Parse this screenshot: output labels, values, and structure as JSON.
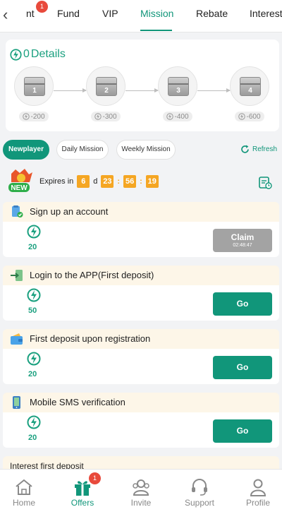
{
  "top_tabs": {
    "back_icon": "chevron-left-icon",
    "tabs": [
      {
        "label": "nt",
        "badge": "1"
      },
      {
        "label": "Fund"
      },
      {
        "label": "VIP"
      },
      {
        "label": "Mission",
        "active": true
      },
      {
        "label": "Rebate"
      },
      {
        "label": "Interest"
      }
    ]
  },
  "details": {
    "points": "0",
    "label": "Details",
    "chests": [
      {
        "number": "1",
        "reward": "-200"
      },
      {
        "number": "2",
        "reward": "-300"
      },
      {
        "number": "3",
        "reward": "-400"
      },
      {
        "number": "4",
        "reward": "-600"
      }
    ]
  },
  "filters": {
    "newplayer": "Newplayer",
    "daily": "Daily Mission",
    "weekly": "Weekly Mission",
    "refresh": "Refresh"
  },
  "expires": {
    "label": "Expires in",
    "days": "6",
    "d": "d",
    "hours": "23",
    "minutes": "56",
    "seconds": "19",
    "badge_text": "NEW"
  },
  "missions": [
    {
      "title": "Sign up an account",
      "points": "20",
      "button": "Claim",
      "button_sub": "02:48:47",
      "state": "claim"
    },
    {
      "title": "Login to the APP(First deposit)",
      "points": "50",
      "button": "Go",
      "state": "go"
    },
    {
      "title": "First deposit upon registration",
      "points": "20",
      "button": "Go",
      "state": "go"
    },
    {
      "title": "Mobile SMS verification",
      "points": "20",
      "button": "Go",
      "state": "go"
    }
  ],
  "partial_mission": {
    "title": "Interest first deposit"
  },
  "bottom_nav": [
    {
      "label": "Home",
      "icon": "home-icon"
    },
    {
      "label": "Offers",
      "icon": "gift-icon",
      "active": true,
      "badge": "1"
    },
    {
      "label": "Invite",
      "icon": "invite-icon"
    },
    {
      "label": "Support",
      "icon": "headset-icon"
    },
    {
      "label": "Profile",
      "icon": "profile-icon"
    }
  ],
  "colors": {
    "accent": "#11967a",
    "accent_light": "#1aa07f",
    "timer": "#f5a623",
    "badge": "#e84a3c",
    "claim_disabled": "#a3a3a3"
  }
}
